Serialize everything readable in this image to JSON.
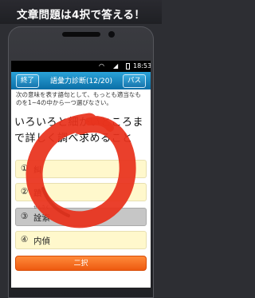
{
  "promo": {
    "headline": "文章問題は4択で答える！"
  },
  "status_bar": {
    "time": "18:53"
  },
  "quiz": {
    "end_label": "終了",
    "title": "語彙力診断(12/20)",
    "pass_label": "パス",
    "instruction": "次の意味を表す語句として、もっとも適当なものを1~4の中から一つ選びなさい。",
    "question": "いろいろと細かいところまで詳しく調べ求めること",
    "options": [
      {
        "number": "①",
        "text": "糾"
      },
      {
        "number": "②",
        "text": "蹟"
      },
      {
        "number": "③",
        "text": "詮索",
        "furigana": "せんさく",
        "selected": true
      },
      {
        "number": "④",
        "text": "内偵"
      }
    ],
    "two_choice_label": "二択"
  },
  "colors": {
    "nav_blue": "#1a8fcc",
    "option_yellow": "#fff8cc",
    "accent_orange": "#f26a1b",
    "correct_mark_red": "#e8321c"
  }
}
